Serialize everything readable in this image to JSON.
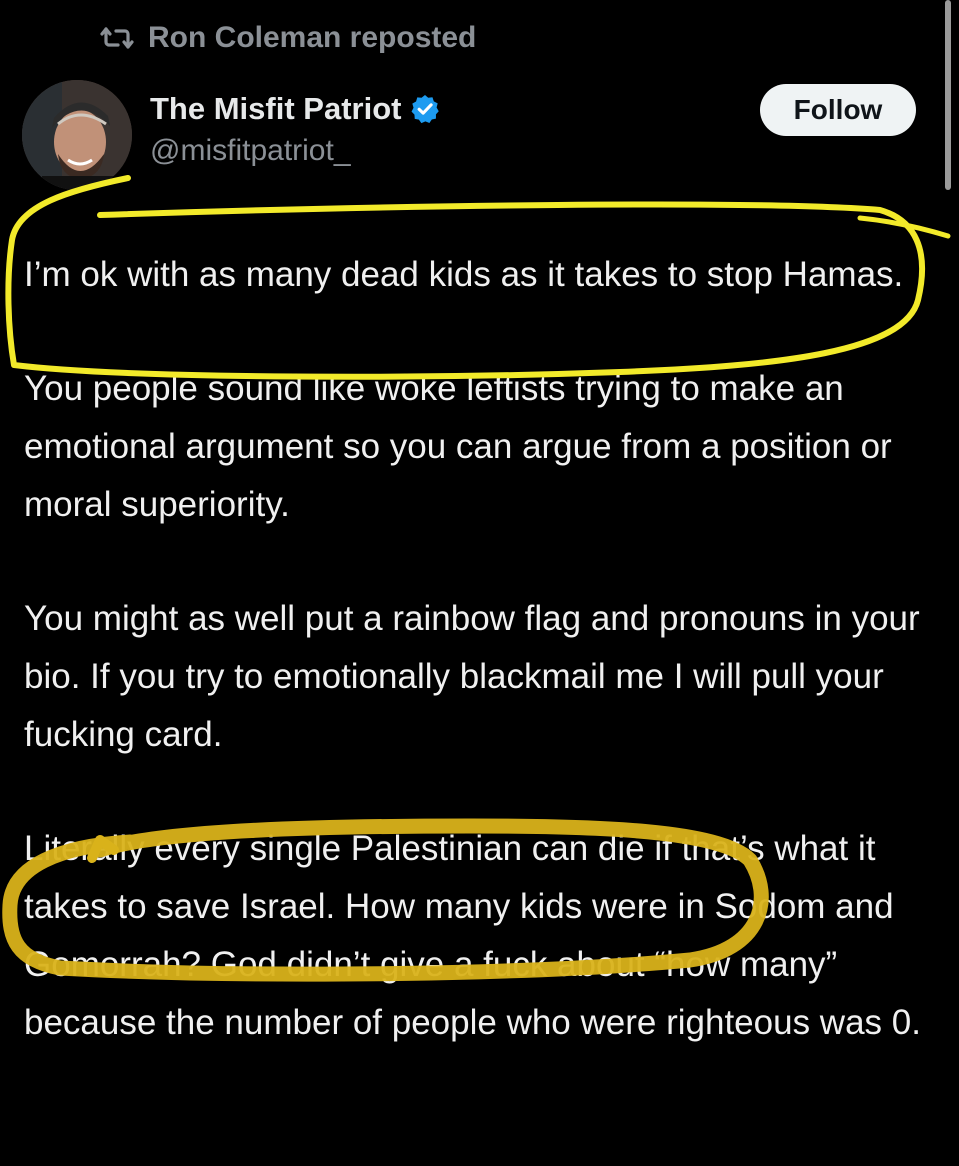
{
  "repost": {
    "icon": "repost-icon",
    "text": "Ron Coleman reposted"
  },
  "author": {
    "avatar_icon": "avatar",
    "name": "The Misfit Patriot",
    "verified_icon": "verified-badge-icon",
    "handle": "@misfitpatriot_"
  },
  "follow_label": "Follow",
  "post": {
    "paragraphs": [
      "I’m ok with as many dead kids as it takes to stop Hamas.",
      "You people sound like woke leftists trying to make an emotional argument so you can argue from a position or moral superiority.",
      "You might as well put a rainbow flag and pronouns in your bio. If you try to emotionally blackmail me I will pull your fucking card.",
      "Literally every single Palestinian can die if that’s what it takes to save Israel. How many kids were in Sodom and Gomorrah? God didn’t give a fuck about “how many” because the number of people who were righteous was 0."
    ]
  },
  "colors": {
    "background": "#000000",
    "text": "#e7e9ea",
    "muted": "#8b9096",
    "verified": "#1d9bf0",
    "highlight_yellow": "#f2ea2a",
    "highlight_gold": "#d9b21a"
  }
}
